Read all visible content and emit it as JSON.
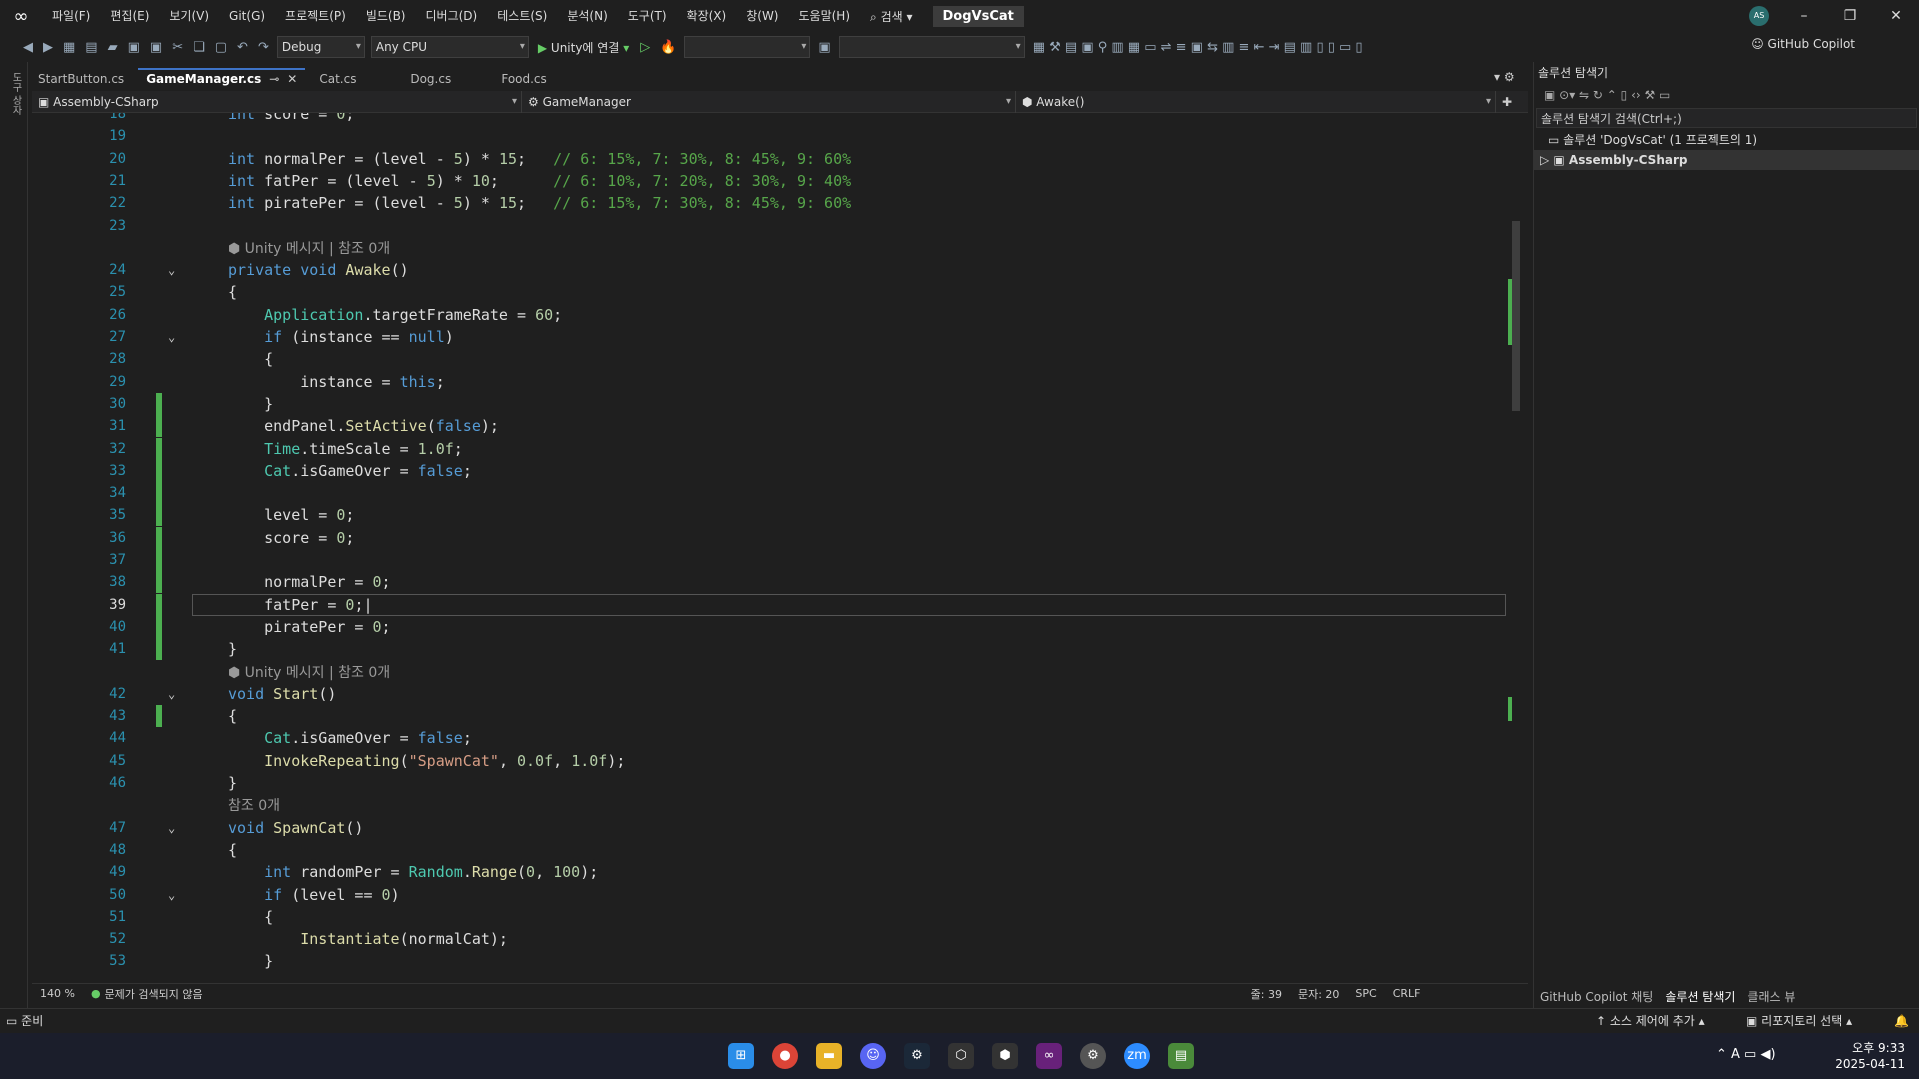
{
  "menu": [
    "파일(F)",
    "편집(E)",
    "보기(V)",
    "Git(G)",
    "프로젝트(P)",
    "빌드(B)",
    "디버그(D)",
    "테스트(S)",
    "분석(N)",
    "도구(T)",
    "확장(X)",
    "창(W)",
    "도움말(H)"
  ],
  "search_label": "검색",
  "solution_title": "DogVsCat",
  "avatar": "AS",
  "toolbar": {
    "config": "Debug",
    "platform": "Any CPU",
    "run_label": "Unity에 연결",
    "copilot": "GitHub Copilot"
  },
  "left_strip_label": "도구 상자",
  "tabs": [
    {
      "label": "StartButton.cs",
      "active": false
    },
    {
      "label": "GameManager.cs",
      "active": true
    },
    {
      "label": "Cat.cs",
      "active": false
    },
    {
      "label": "Dog.cs",
      "active": false
    },
    {
      "label": "Food.cs",
      "active": false
    }
  ],
  "nav": {
    "project": "Assembly-CSharp",
    "class": "GameManager",
    "member": "Awake()"
  },
  "code_lines": [
    {
      "n": "18",
      "html": "<span class='kw'>int</span> score = <span class='num'>0</span>;"
    },
    {
      "n": "19",
      "html": ""
    },
    {
      "n": "20",
      "html": "<span class='kw'>int</span> normalPer = (level - <span class='num'>5</span>) * <span class='num'>15</span>;   <span class='cm'>// 6: 15%, 7: 30%, 8: 45%, 9: 60%</span>"
    },
    {
      "n": "21",
      "html": "<span class='kw'>int</span> fatPer = (level - <span class='num'>5</span>) * <span class='num'>10</span>;      <span class='cm'>// 6: 10%, 7: 20%, 8: 30%, 9: 40%</span>"
    },
    {
      "n": "22",
      "html": "<span class='kw'>int</span> piratePer = (level - <span class='num'>5</span>) * <span class='num'>15</span>;   <span class='cm'>// 6: 15%, 7: 30%, 8: 45%, 9: 60%</span>"
    },
    {
      "n": "23",
      "html": ""
    },
    {
      "n": "",
      "html": "<span class='codelens'>⬢ Unity 메시지 | 참조 0개</span>"
    },
    {
      "n": "24",
      "fold": true,
      "html": "<span class='kw'>private void</span> <span class='fn'>Awake</span>()"
    },
    {
      "n": "25",
      "html": "{"
    },
    {
      "n": "26",
      "html": "    <span class='ty'>Application</span>.targetFrameRate = <span class='num'>60</span>;"
    },
    {
      "n": "27",
      "fold": true,
      "html": "    <span class='kw'>if</span> (instance == <span class='kw'>null</span>)"
    },
    {
      "n": "28",
      "html": "    {"
    },
    {
      "n": "29",
      "html": "        instance = <span class='kw'>this</span>;"
    },
    {
      "n": "30",
      "chg": true,
      "html": "    }"
    },
    {
      "n": "31",
      "chg": true,
      "html": "    endPanel.<span class='fn'>SetActive</span>(<span class='kw'>false</span>);"
    },
    {
      "n": "32",
      "chg": true,
      "html": "    <span class='ty'>Time</span>.timeScale = <span class='num'>1.0f</span>;"
    },
    {
      "n": "33",
      "chg": true,
      "html": "    <span class='ty'>Cat</span>.isGameOver = <span class='kw'>false</span>;"
    },
    {
      "n": "34",
      "chg": true,
      "html": ""
    },
    {
      "n": "35",
      "chg": true,
      "html": "    level = <span class='num'>0</span>;"
    },
    {
      "n": "36",
      "chg": true,
      "html": "    score = <span class='num'>0</span>;"
    },
    {
      "n": "37",
      "chg": true,
      "html": ""
    },
    {
      "n": "38",
      "chg": true,
      "html": "    normalPer = <span class='num'>0</span>;"
    },
    {
      "n": "39",
      "chg": true,
      "cur": true,
      "html": "    fatPer = <span class='num'>0</span>;|"
    },
    {
      "n": "40",
      "chg": true,
      "html": "    piratePer = <span class='num'>0</span>;"
    },
    {
      "n": "41",
      "chg": true,
      "html": "}"
    },
    {
      "n": "",
      "html": "<span class='codelens'>⬢ Unity 메시지 | 참조 0개</span>"
    },
    {
      "n": "42",
      "fold": true,
      "html": "<span class='kw'>void</span> <span class='fn'>Start</span>()"
    },
    {
      "n": "43",
      "chg": true,
      "html": "{"
    },
    {
      "n": "44",
      "html": "    <span class='ty'>Cat</span>.isGameOver = <span class='kw'>false</span>;"
    },
    {
      "n": "45",
      "html": "    <span class='fn'>InvokeRepeating</span>(<span class='str'>\"SpawnCat\"</span>, <span class='num'>0.0f</span>, <span class='num'>1.0f</span>);"
    },
    {
      "n": "46",
      "html": "}"
    },
    {
      "n": "",
      "html": "<span class='codelens'>참조 0개</span>"
    },
    {
      "n": "47",
      "fold": true,
      "html": "<span class='kw'>void</span> <span class='fn'>SpawnCat</span>()"
    },
    {
      "n": "48",
      "html": "{"
    },
    {
      "n": "49",
      "html": "    <span class='kw'>int</span> randomPer = <span class='ty'>Random</span>.<span class='fn'>Range</span>(<span class='num'>0</span>, <span class='num'>100</span>);"
    },
    {
      "n": "50",
      "fold": true,
      "html": "    <span class='kw'>if</span> (level == <span class='num'>0</span>)"
    },
    {
      "n": "51",
      "html": "    {"
    },
    {
      "n": "52",
      "html": "        <span class='fn'>Instantiate</span>(normalCat);"
    },
    {
      "n": "53",
      "html": "    }"
    }
  ],
  "editor_status": {
    "zoom": "140 %",
    "issues": "문제가 검색되지 않음",
    "line": "줄: 39",
    "col": "문자: 20",
    "spc": "SPC",
    "eol": "CRLF"
  },
  "solution_panel": {
    "title": "솔루션 탐색기",
    "search": "솔루션 탐색기 검색(Ctrl+;)",
    "solution": "솔루션 'DogVsCat' (1 프로젝트의 1)",
    "project": "Assembly-CSharp",
    "tabs": [
      "GitHub Copilot 채팅",
      "솔루션 탐색기",
      "클래스 뷰"
    ]
  },
  "status": {
    "ready": "준비",
    "source_control": "소스 제어에 추가",
    "repo": "리포지토리 선택"
  },
  "clock": {
    "time": "오후 9:33",
    "date": "2025-04-11"
  },
  "taskbar_apps": [
    "windows-start",
    "chrome",
    "file-explorer",
    "discord",
    "steam",
    "unity-hub",
    "unity",
    "visual-studio",
    "settings",
    "zoom",
    "notepad"
  ]
}
